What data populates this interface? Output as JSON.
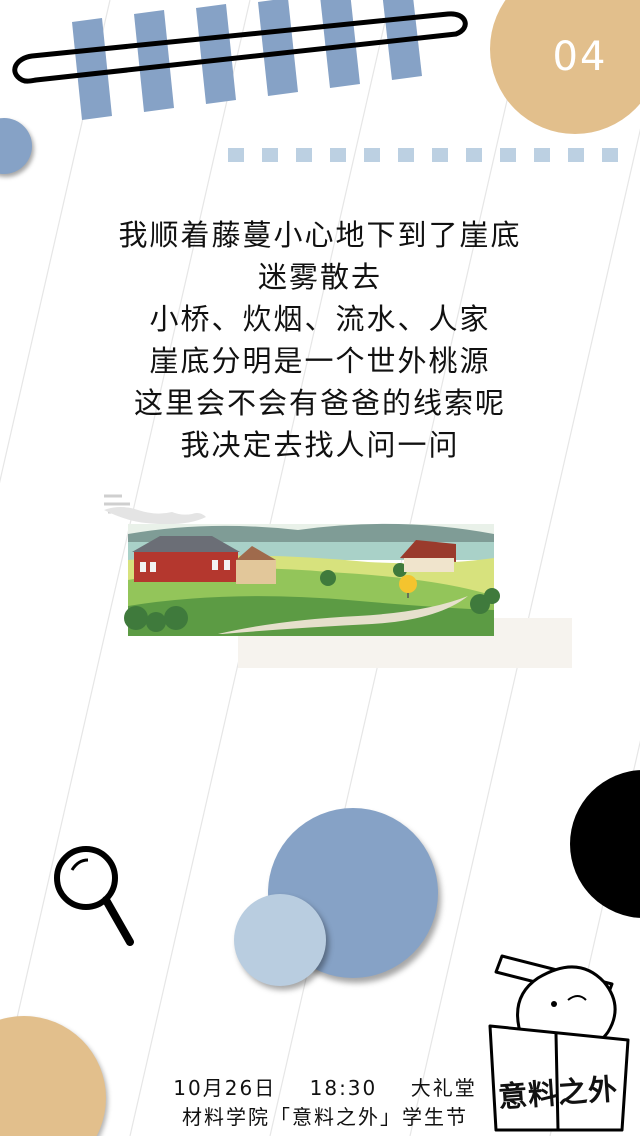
{
  "page": {
    "number": "04"
  },
  "poem": {
    "lines": [
      "我顺着藤蔓小心地下到了崖底",
      "迷雾散去",
      "小桥、炊烟、流水、人家",
      "崖底分明是一个世外桃源",
      "这里会不会有爸爸的线索呢",
      "我决定去找人问一问"
    ]
  },
  "footer": {
    "event_info": "10月26日    18:30    大礼堂",
    "organizer": "材料学院「意料之外」学生节"
  },
  "logo": {
    "text": "意料之外"
  },
  "colors": {
    "blue": "#86a2c6",
    "light_blue": "#b9cde0",
    "tan": "#e2bf8c",
    "black": "#000000",
    "line_gray": "#d8d8d8"
  },
  "icons": [
    "magnifier-icon",
    "elephant-box-logo"
  ]
}
